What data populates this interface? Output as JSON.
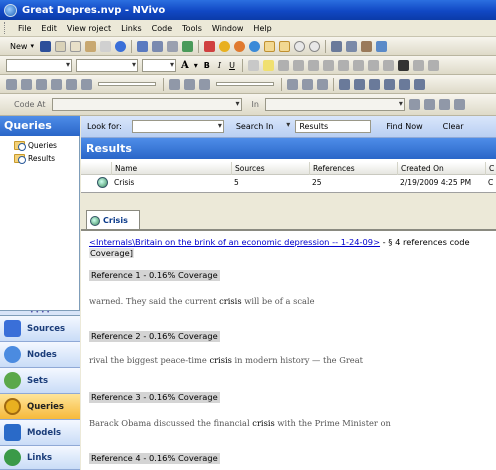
{
  "window": {
    "title": "Great Depres.nvp - NVivo"
  },
  "menu": [
    "File",
    "Edit",
    "View roject",
    "Links",
    "Code",
    "Tools",
    "Window",
    "Help"
  ],
  "toolbar": {
    "new_label": "New",
    "code_at_label": "Code At",
    "in_label": "In"
  },
  "sidebar": {
    "title": "Queries",
    "tree": [
      {
        "label": "Queries"
      },
      {
        "label": "Results"
      }
    ],
    "nav": [
      {
        "label": "Sources",
        "color": "#3a6fd8"
      },
      {
        "label": "Nodes",
        "color": "#4b8be0"
      },
      {
        "label": "Sets",
        "color": "#5ba84a"
      },
      {
        "label": "Queries",
        "color": "#e8b020"
      },
      {
        "label": "Models",
        "color": "#2a6ac8"
      },
      {
        "label": "Links",
        "color": "#3a9a48"
      }
    ]
  },
  "find": {
    "look_for_label": "Look for:",
    "search_in_label": "Search In",
    "search_in_value": "Results",
    "find_now": "Find Now",
    "clear": "Clear"
  },
  "results": {
    "title": "Results",
    "columns": [
      "Name",
      "Sources",
      "References",
      "Created On",
      "C"
    ],
    "rows": [
      {
        "name": "Crisis",
        "sources": "5",
        "references": "25",
        "created_on": "2/19/2009 4:25 PM",
        "c": "C"
      }
    ]
  },
  "detail": {
    "tab_label": "Crisis",
    "source_link": "<Internals\\Britain on the brink of an economic depression -- 1-24-09>",
    "source_suffix": " - § 4 references code",
    "coverage_line": "Coverage]",
    "references": [
      {
        "label": "Reference 1 - 0.16% Coverage",
        "before": "warned. They said the current ",
        "term": "crisis",
        "after": " will be of a scale"
      },
      {
        "label": "Reference 2 - 0.16% Coverage",
        "before": "rival the biggest peace-time ",
        "term": "crisis",
        "after": " in modern history — the Great"
      },
      {
        "label": "Reference 3 - 0.16% Coverage",
        "before": "Barack Obama discussed the financial ",
        "term": "crisis",
        "after": " with the Prime Minister on"
      },
      {
        "label": "Reference 4 - 0.16% Coverage"
      }
    ]
  }
}
